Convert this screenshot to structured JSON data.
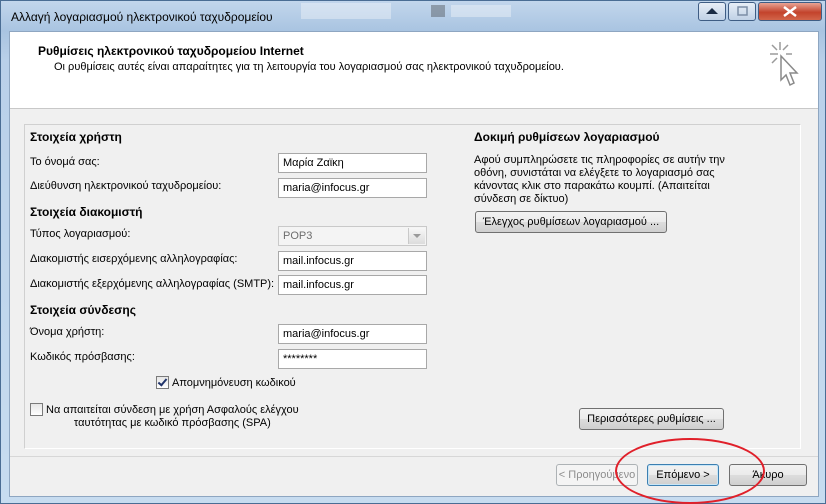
{
  "window": {
    "title": "Αλλαγή λογαριασμού ηλεκτρονικού ταχυδρομείου"
  },
  "header": {
    "title": "Ρυθμίσεις ηλεκτρονικού ταχυδρομείου Internet",
    "subtitle": "Οι ρυθμίσεις αυτές είναι απαραίτητες για τη λειτουργία του λογαριασμού σας ηλεκτρονικού ταχυδρομείου."
  },
  "user_info": {
    "heading": "Στοιχεία χρήστη",
    "name_label": "Το όνομά σας:",
    "name_value": "Μαρία Ζαϊκη",
    "email_label": "Διεύθυνση ηλεκτρονικού ταχυδρομείου:",
    "email_value": "maria@infocus.gr"
  },
  "server_info": {
    "heading": "Στοιχεία διακομιστή",
    "account_type_label": "Τύπος λογαριασμού:",
    "account_type_value": "POP3",
    "incoming_label": "Διακομιστής εισερχόμενης αλληλογραφίας:",
    "incoming_value": "mail.infocus.gr",
    "outgoing_label": "Διακομιστής εξερχόμενης αλληλογραφίας (SMTP):",
    "outgoing_value": "mail.infocus.gr"
  },
  "login_info": {
    "heading": "Στοιχεία σύνδεσης",
    "username_label": "Όνομα χρήστη:",
    "username_value": "maria@infocus.gr",
    "password_label": "Κωδικός πρόσβασης:",
    "password_value": "********",
    "remember_label": "Απομνημόνευση κωδικού",
    "remember_checked": true,
    "spa_label_line1": "Να απαιτείται σύνδεση με χρήση Ασφαλούς ελέγχου",
    "spa_label_line2": "ταυτότητας με κωδικό πρόσβασης (SPA)",
    "spa_checked": false
  },
  "test": {
    "heading": "Δοκιμή ρυθμίσεων λογαριασμού",
    "description_lines": [
      "Αφού συμπληρώσετε τις πληροφορίες σε αυτήν την",
      "οθόνη, συνιστάται να ελέγξετε το λογαριασμό σας",
      "κάνοντας κλικ στο παρακάτω κουμπί. (Απαιτείται",
      "σύνδεση σε δίκτυο)"
    ],
    "test_button": "Έλεγχος ρυθμίσεων λογαριασμού ..."
  },
  "more_settings_button": "Περισσότερες ρυθμίσεις ...",
  "footer": {
    "back_button": "< Προηγούμενο",
    "next_button": "Επόμενο >",
    "cancel_button": "Άκυρο"
  },
  "colors": {
    "highlight_ring": "#e0202a",
    "dialog_background": "#f0f0f0"
  }
}
